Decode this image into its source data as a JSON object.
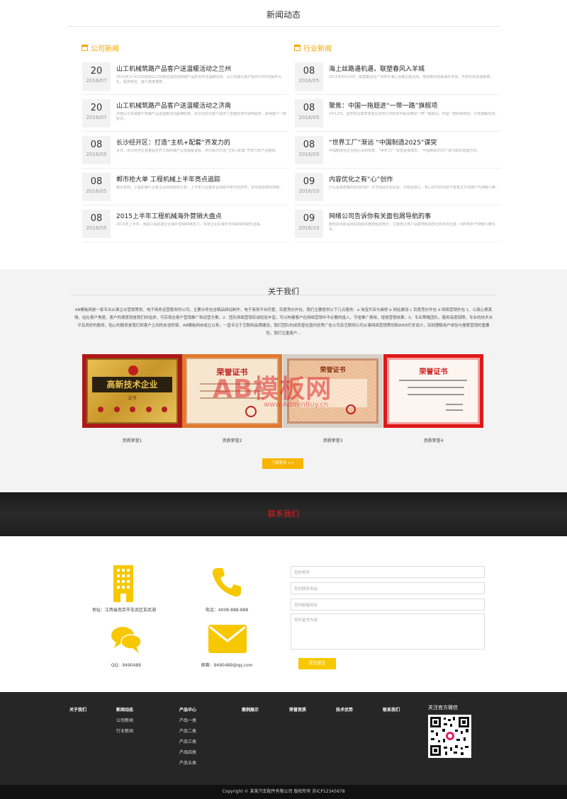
{
  "news": {
    "title": "新闻动态",
    "company_head": "公司新闻",
    "industry_head": "行业新闻",
    "company_items": [
      {
        "day": "20",
        "ym": "2016/07",
        "title": "山工机械筑路产品客户送温暖活动之兰州",
        "desc": "2014年11月22日启动山工机械全国范围筑路产品的关怀送温暖活动，山工机械为客户提供1000元服务大礼，服务到位，客户高度满意。"
      },
      {
        "day": "20",
        "ym": "2016/07",
        "title": "山工机械筑路产品客户送温暖活动之济南",
        "desc": "济南山工机械客户筑路产品送温暖活动圆满结束，本次活动为客户提供了全面检测与保养服务，获得客户一致好评。"
      },
      {
        "day": "08",
        "ym": "2016/05",
        "title": "长沙经开区：打造“主机+配套”齐发力的",
        "desc": "近日，长沙经开区管委会召开工程机械产业发展座谈会，共同探讨打造“主机+配套”齐发力的产业格局。"
      },
      {
        "day": "08",
        "ym": "2016/05",
        "title": "郸市抢大单 工程机械上半年亮点追踪",
        "desc": "截至目前，工程机械行业各企业纷纷抢抓订单，上半年行业整体呈现稳中有升的态势，多项指标表现亮眼。"
      },
      {
        "day": "08",
        "ym": "2016/05",
        "title": "2015上半年工程机械海外营销大盘点",
        "desc": "2015年上半年，我国工程机械企业海外营销持续发力，多家企业在海外市场取得突破性进展。"
      }
    ],
    "industry_items": [
      {
        "day": "08",
        "ym": "2016/05",
        "title": "海上丝路遇机遇，联塑春风入羊城",
        "desc": "2015年4月24日，联塑集团在广州举办海上丝路主题活动，借助春风拓展海外市场，开启全新发展篇章。"
      },
      {
        "day": "08",
        "ym": "2016/05",
        "title": "聚焦：中国一拖题进“一带一路”旗舰项",
        "desc": "3月12日，国务院总理李克强在政府工作报告中提出推进一带一路建设，中国一拖积极响应，打造旗舰项目。"
      },
      {
        "day": "08",
        "ym": "2016/05",
        "title": "“世界工厂”渐远 “中国制造2025”谋突",
        "desc": "中国制造业正在经历深刻变革，“世界工厂”标签逐渐褪去，“中国制造2025”成为新的发展方向。"
      },
      {
        "day": "09",
        "ym": "2016/10",
        "title": "内容优化之有“心”创作",
        "desc": "什么是高质量的原创内容？对于网站优化而言，内容是核心，有心创作的内容才能真正打动用户与搜索引擎。"
      },
      {
        "day": "09",
        "ym": "2016/10",
        "title": "网络公司告诉你有关面包屑导航的事",
        "desc": "面包屑导航是网站导航的重要组成部分，它能够让用户清楚地知道自己所处的位置，同时有利于搜索引擎优化。"
      }
    ]
  },
  "about": {
    "title": "关于我们",
    "text": "AB模板网是一家专业从事企业营销策划、电子商务运营服务的公司，主要业务包含精品网站制作、电子商务平台托管、百度竞价外包。我们主要提供以下几点服务：a 淘宝开店与装修 b 网站建设 c 百度竞价外包 d 网络营销外包 1、以真心换真情，站在客户角度，客户的满意就是我们的追求，可实现在客户营销推广和经营方案。2、团队网络营销实战经验丰富，可以构建客户在网络营销中不必要的投入，节省推广费用，增强营销效果。3、专业策略团队，服务高度保障，专业的技术水平及良好的服务，贴心的服务是我们和客户之间的友谊桥梁。AB模板网自成立以来，一直专注于互联网品牌建设，我们团队的成员曾在国内优秀广告公司及互联网公司从事网络营销策划和WEB开发设计，深刻理解用户体验与搜索营销的重要性。我们注重客户...",
    "certs": [
      {
        "caption": "资质荣誉1",
        "text1": "高新技术企业",
        "text2": "证书"
      },
      {
        "caption": "资质荣誉2",
        "text1": "荣誉证书"
      },
      {
        "caption": "资质荣誉3",
        "text1": "荣誉证书"
      },
      {
        "caption": "资质荣誉4",
        "text1": "荣誉证书"
      }
    ],
    "more_label": "了解更多 >>",
    "watermark": "AB模板网",
    "watermark_sub": "www.AdminBuy.cn"
  },
  "contact": {
    "title": "联系我们",
    "address": "地址：江西省南京市玄武区玄武湖",
    "phone": "电话：4008-888-888",
    "qq": "QQ：9490489",
    "email": "邮箱：9490489@qq.com",
    "name_placeholder": "您的称呼",
    "phone_placeholder": "您的联系电话",
    "email_placeholder": "您的邮箱地址",
    "message_placeholder": "您的留言内容",
    "submit_label": "提交留言"
  },
  "footer": {
    "columns": [
      {
        "head": "关于我们",
        "links": []
      },
      {
        "head": "新闻动态",
        "links": [
          "公司新闻",
          "行业新闻"
        ]
      },
      {
        "head": "产品中心",
        "links": [
          "产品一类",
          "产品二类",
          "产品三类",
          "产品四类",
          "产品五类"
        ]
      },
      {
        "head": "案例展示",
        "links": []
      },
      {
        "head": "荣誉资质",
        "links": []
      },
      {
        "head": "技术优势",
        "links": []
      },
      {
        "head": "联系我们",
        "links": []
      }
    ],
    "wechat_title": "关注官方微信",
    "copyright": "Copyright © 某某汽车配件有限公司 版权所有   苏ICP12345678"
  },
  "colors": {
    "accent": "#f7b500",
    "contact_red": "#e02020",
    "footer_bg": "#262626"
  }
}
